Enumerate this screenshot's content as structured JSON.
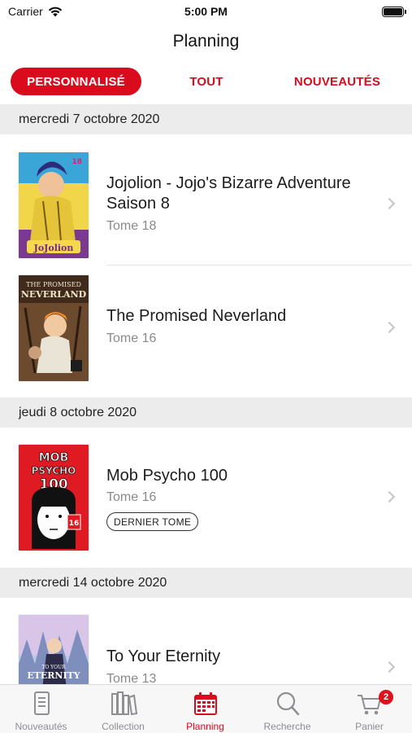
{
  "status_bar": {
    "carrier": "Carrier",
    "time": "5:00 PM"
  },
  "nav": {
    "title": "Planning"
  },
  "tabs": [
    {
      "label": "PERSONNALISÉ",
      "active": true
    },
    {
      "label": "TOUT",
      "active": false
    },
    {
      "label": "NOUVEAUTÉS",
      "active": false
    }
  ],
  "sections": [
    {
      "date": "mercredi 7 octobre 2020",
      "items": [
        {
          "title": "Jojolion - Jojo's Bizarre Adventure Saison 8",
          "subtitle": "Tome 18",
          "cover_text": "JoJolion"
        },
        {
          "title": "The Promised Neverland",
          "subtitle": "Tome 16",
          "cover_text": "Neverland"
        }
      ]
    },
    {
      "date": "jeudi 8 octobre 2020",
      "items": [
        {
          "title": "Mob Psycho 100",
          "subtitle": "Tome 16",
          "badge": "DERNIER TOME",
          "cover_text": "MOB PSYCHO 100"
        }
      ]
    },
    {
      "date": "mercredi 14 octobre 2020",
      "items": [
        {
          "title": "To Your Eternity",
          "subtitle": "Tome 13",
          "cover_text": "ETERNITY"
        }
      ]
    }
  ],
  "tabbar": {
    "items": [
      {
        "label": "Nouveautés",
        "icon": "document-icon"
      },
      {
        "label": "Collection",
        "icon": "books-icon"
      },
      {
        "label": "Planning",
        "icon": "calendar-icon",
        "active": true
      },
      {
        "label": "Recherche",
        "icon": "search-icon"
      },
      {
        "label": "Panier",
        "icon": "cart-icon",
        "badge": "2"
      }
    ]
  },
  "colors": {
    "accent": "#d90b1c",
    "section_bg": "#ececec",
    "inactive_gray": "#8e8e93"
  }
}
